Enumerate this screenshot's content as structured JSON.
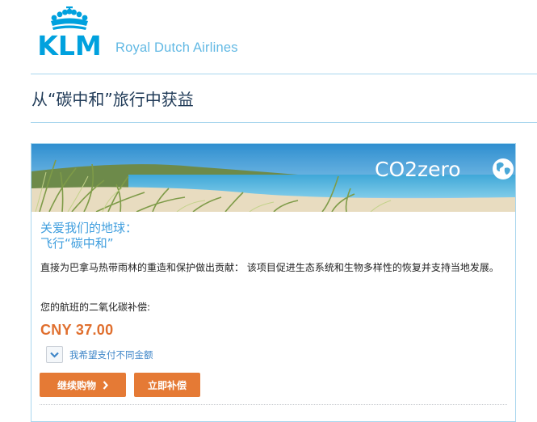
{
  "header": {
    "logo_text": "KLM",
    "tagline": "Royal Dutch Airlines"
  },
  "page": {
    "title": "从“碳中和”旅行中获益"
  },
  "card": {
    "banner_logo": "CO2zero",
    "heading_line1": "关爱我们的地球：",
    "heading_line2": "飞行“碳中和”",
    "description": "直接为巴拿马热带雨林的重造和保护做出贡献： 该项目促进生态系统和生物多样性的恢复并支持当地发展。",
    "compensation_label": "您的航班的二氧化碳补偿:",
    "amount": "CNY 37.00",
    "different_amount_label": "我希望支付不同金额",
    "continue_button": "继续购物",
    "compensate_button": "立即补偿"
  },
  "colors": {
    "brand_blue": "#00a1de",
    "accent_orange": "#e57a35",
    "heading_blue": "#3f9ede",
    "amount_orange": "#e06f2e"
  }
}
